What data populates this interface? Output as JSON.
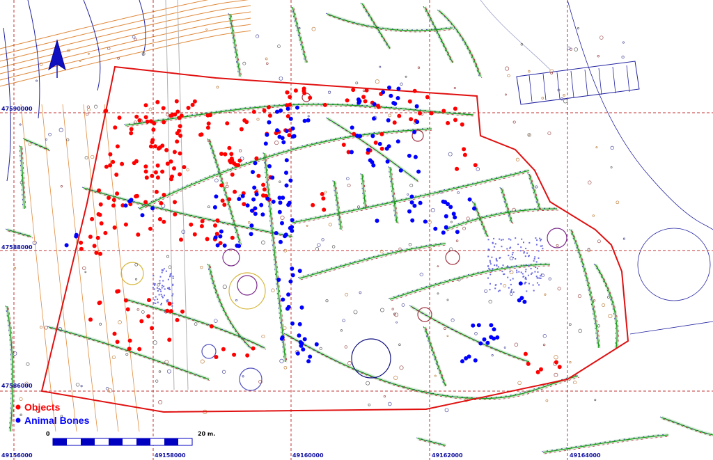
{
  "map": {
    "grid_labels_x": [
      "49156000",
      "49158000",
      "49160000",
      "49162000",
      "49164000"
    ],
    "grid_labels_y": [
      "47590000",
      "47588000",
      "47586000"
    ],
    "colors": {
      "grid": "#c03030",
      "boundary": "#e01010",
      "features": "#1a9a1a",
      "contours": "#e08a3c",
      "annotations": "#2020a0",
      "objects": "#ff0000",
      "animal_bones": "#0000ff"
    },
    "north_arrow_icon": "north-arrow-icon"
  },
  "legend": {
    "objects_label": "Objects",
    "animal_bones_label": "Animal Bones"
  },
  "scale_bar": {
    "start_label": "0",
    "end_label": "20 m."
  }
}
